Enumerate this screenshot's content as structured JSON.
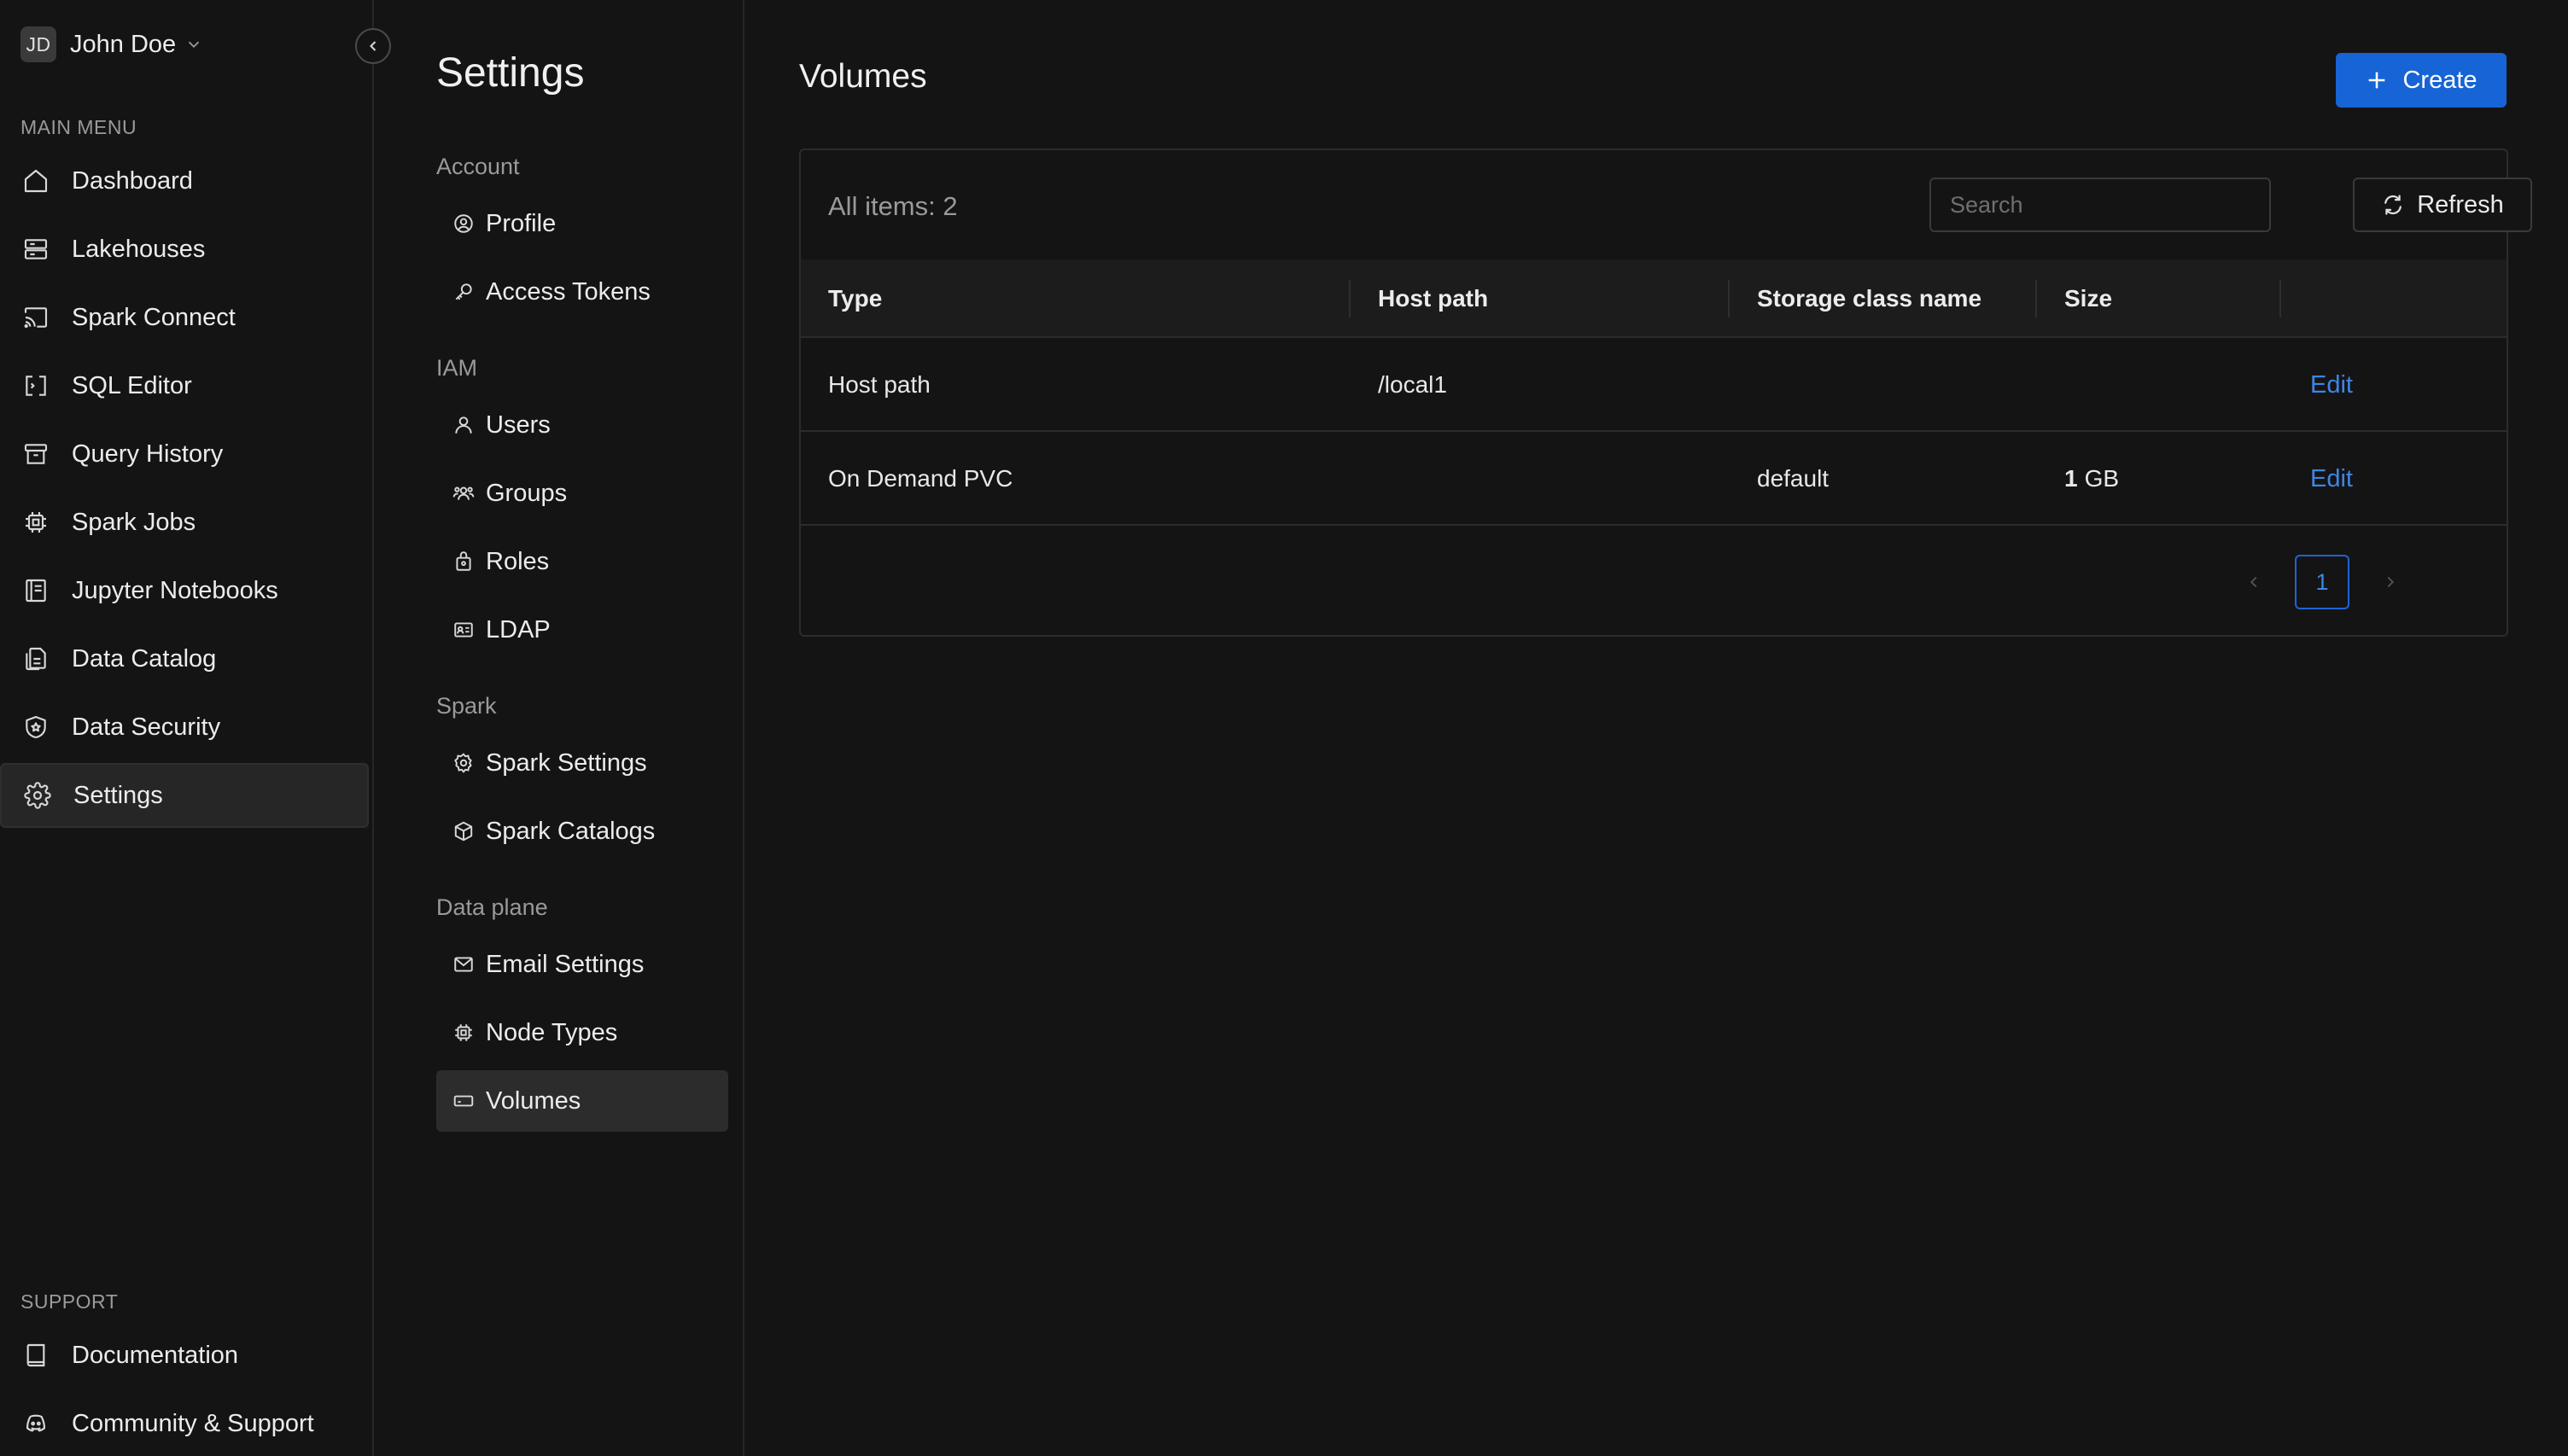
{
  "user": {
    "initials": "JD",
    "name": "John Doe"
  },
  "sidebar": {
    "main_menu_label": "MAIN MENU",
    "items": [
      {
        "label": "Dashboard",
        "icon": "home-icon"
      },
      {
        "label": "Lakehouses",
        "icon": "server-icon"
      },
      {
        "label": "Spark Connect",
        "icon": "cast-icon"
      },
      {
        "label": "SQL Editor",
        "icon": "code-bracket-icon"
      },
      {
        "label": "Query History",
        "icon": "archive-icon"
      },
      {
        "label": "Spark Jobs",
        "icon": "chip-icon"
      },
      {
        "label": "Jupyter Notebooks",
        "icon": "notebook-icon"
      },
      {
        "label": "Data Catalog",
        "icon": "documents-icon"
      },
      {
        "label": "Data Security",
        "icon": "shield-star-icon"
      },
      {
        "label": "Settings",
        "icon": "gear-icon",
        "active": true
      }
    ],
    "support_label": "SUPPORT",
    "support_items": [
      {
        "label": "Documentation",
        "icon": "book-icon"
      },
      {
        "label": "Community & Support",
        "icon": "discord-icon"
      }
    ]
  },
  "settings": {
    "title": "Settings",
    "groups": [
      {
        "label": "Account",
        "items": [
          {
            "label": "Profile",
            "icon": "user-circle-icon"
          },
          {
            "label": "Access Tokens",
            "icon": "key-icon"
          }
        ]
      },
      {
        "label": "IAM",
        "items": [
          {
            "label": "Users",
            "icon": "user-icon"
          },
          {
            "label": "Groups",
            "icon": "users-icon"
          },
          {
            "label": "Roles",
            "icon": "badge-lock-icon"
          },
          {
            "label": "LDAP",
            "icon": "id-card-icon"
          }
        ]
      },
      {
        "label": "Spark",
        "items": [
          {
            "label": "Spark Settings",
            "icon": "gear-icon"
          },
          {
            "label": "Spark Catalogs",
            "icon": "cube-icon"
          }
        ]
      },
      {
        "label": "Data plane",
        "items": [
          {
            "label": "Email Settings",
            "icon": "mail-icon"
          },
          {
            "label": "Node Types",
            "icon": "chip-icon"
          },
          {
            "label": "Volumes",
            "icon": "hard-drive-icon",
            "active": true
          }
        ]
      }
    ]
  },
  "main": {
    "title": "Volumes",
    "create_label": "Create",
    "items_count": "All items: 2",
    "search_placeholder": "Search",
    "refresh_label": "Refresh",
    "columns": [
      "Type",
      "Host path",
      "Storage class name",
      "Size"
    ],
    "rows": [
      {
        "type": "Host path",
        "host_path": "/local1",
        "storage_class": "",
        "size_num": "",
        "size_unit": "",
        "action": "Edit"
      },
      {
        "type": "On Demand PVC",
        "host_path": "",
        "storage_class": "default",
        "size_num": "1",
        "size_unit": "GB",
        "action": "Edit"
      }
    ],
    "pagination": {
      "current_page": "1"
    }
  },
  "colors": {
    "accent": "#1664d6",
    "link": "#3d86e6",
    "background": "#141414"
  }
}
